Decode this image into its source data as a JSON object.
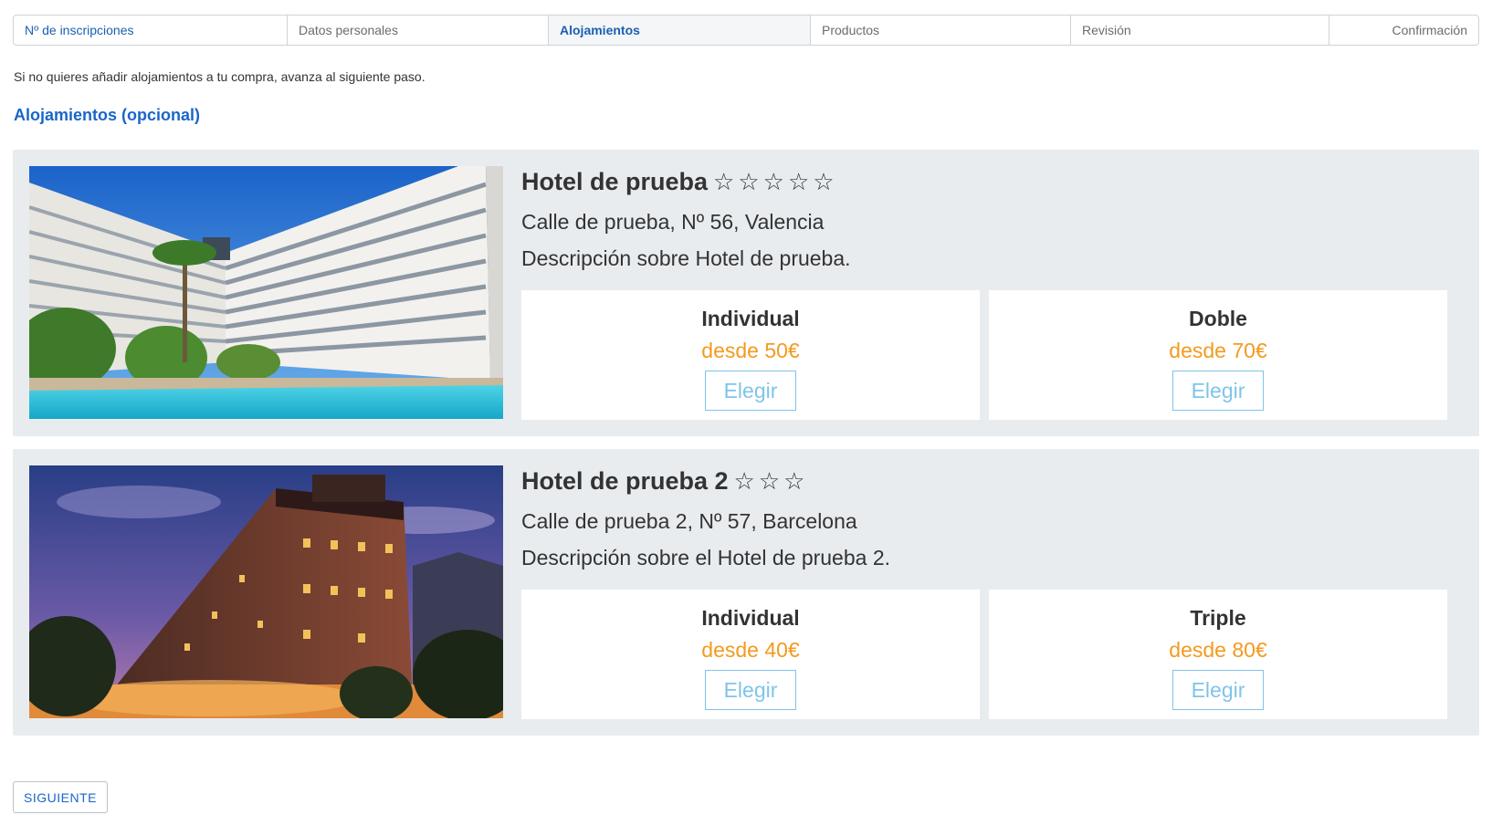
{
  "stepper": {
    "steps": [
      {
        "label": "Nº de inscripciones"
      },
      {
        "label": "Datos personales"
      },
      {
        "label": "Alojamientos"
      },
      {
        "label": "Productos"
      },
      {
        "label": "Revisión"
      },
      {
        "label": "Confirmación"
      }
    ]
  },
  "hint": "Si no quieres añadir alojamientos a tu compra, avanza al siguiente paso.",
  "section_title": "Alojamientos (opcional)",
  "hotels": [
    {
      "name": "Hotel de prueba",
      "stars": "☆☆☆☆☆",
      "address": "Calle de prueba, Nº 56, Valencia",
      "description": "Descripción sobre Hotel de prueba.",
      "rooms": [
        {
          "type": "Individual",
          "price": "desde 50€",
          "button": "Elegir"
        },
        {
          "type": "Doble",
          "price": "desde 70€",
          "button": "Elegir"
        }
      ]
    },
    {
      "name": "Hotel de prueba 2",
      "stars": "☆☆☆",
      "address": "Calle de prueba 2, Nº 57, Barcelona",
      "description": "Descripción sobre el Hotel de prueba 2.",
      "rooms": [
        {
          "type": "Individual",
          "price": "desde 40€",
          "button": "Elegir"
        },
        {
          "type": "Triple",
          "price": "desde 80€",
          "button": "Elegir"
        }
      ]
    }
  ],
  "next_button": "SIGUIENTE",
  "colors": {
    "link_blue": "#1a66c8",
    "price_orange": "#f39a1e",
    "button_light_blue": "#7fc4ea",
    "card_gray": "#e9ecef"
  }
}
